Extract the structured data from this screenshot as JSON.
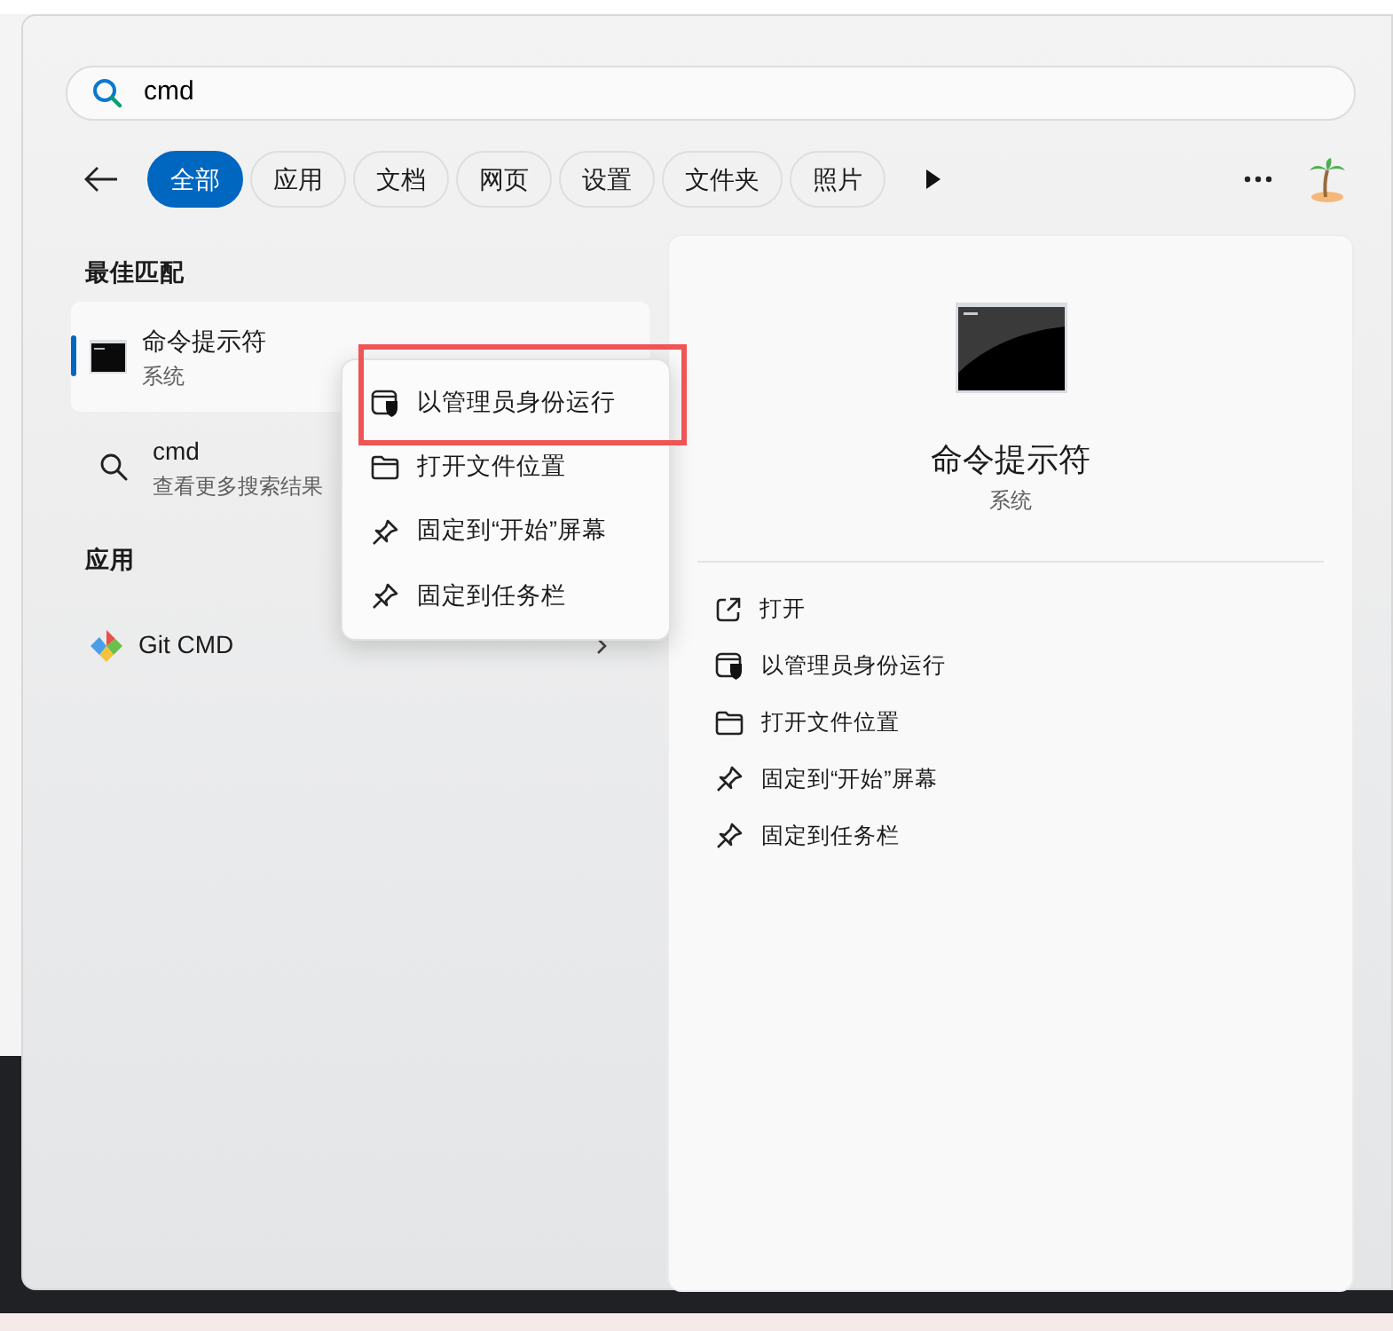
{
  "search": {
    "value": "cmd"
  },
  "filters": [
    {
      "label": "全部",
      "selected": true
    },
    {
      "label": "应用",
      "selected": false
    },
    {
      "label": "文档",
      "selected": false
    },
    {
      "label": "网页",
      "selected": false
    },
    {
      "label": "设置",
      "selected": false
    },
    {
      "label": "文件夹",
      "selected": false
    },
    {
      "label": "照片",
      "selected": false
    }
  ],
  "sections": [
    {
      "heading": "最佳匹配",
      "items": [
        {
          "kind": "console",
          "title": "命令提示符",
          "subtitle": "系统",
          "selected": true
        },
        {
          "kind": "search",
          "title": "cmd",
          "subtitle": "查看更多搜索结果",
          "selected": false
        }
      ]
    },
    {
      "heading": "应用",
      "items": [
        {
          "kind": "git",
          "title": "Git CMD",
          "selected": false
        }
      ]
    }
  ],
  "detail": {
    "title": "命令提示符",
    "subtitle": "系统",
    "actions": [
      {
        "kind": "open",
        "label": "打开"
      },
      {
        "kind": "admin",
        "label": "以管理员身份运行"
      },
      {
        "kind": "folder",
        "label": "打开文件位置"
      },
      {
        "kind": "pin",
        "label": "固定到“开始”屏幕"
      },
      {
        "kind": "pin",
        "label": "固定到任务栏"
      }
    ]
  },
  "context_menu": {
    "items": [
      {
        "kind": "admin",
        "label": "以管理员身份运行",
        "highlighted": true
      },
      {
        "kind": "folder",
        "label": "打开文件位置",
        "highlighted": false
      },
      {
        "kind": "pin",
        "label": "固定到“开始”屏幕",
        "highlighted": false
      },
      {
        "kind": "pin",
        "label": "固定到任务栏",
        "highlighted": false
      }
    ]
  }
}
